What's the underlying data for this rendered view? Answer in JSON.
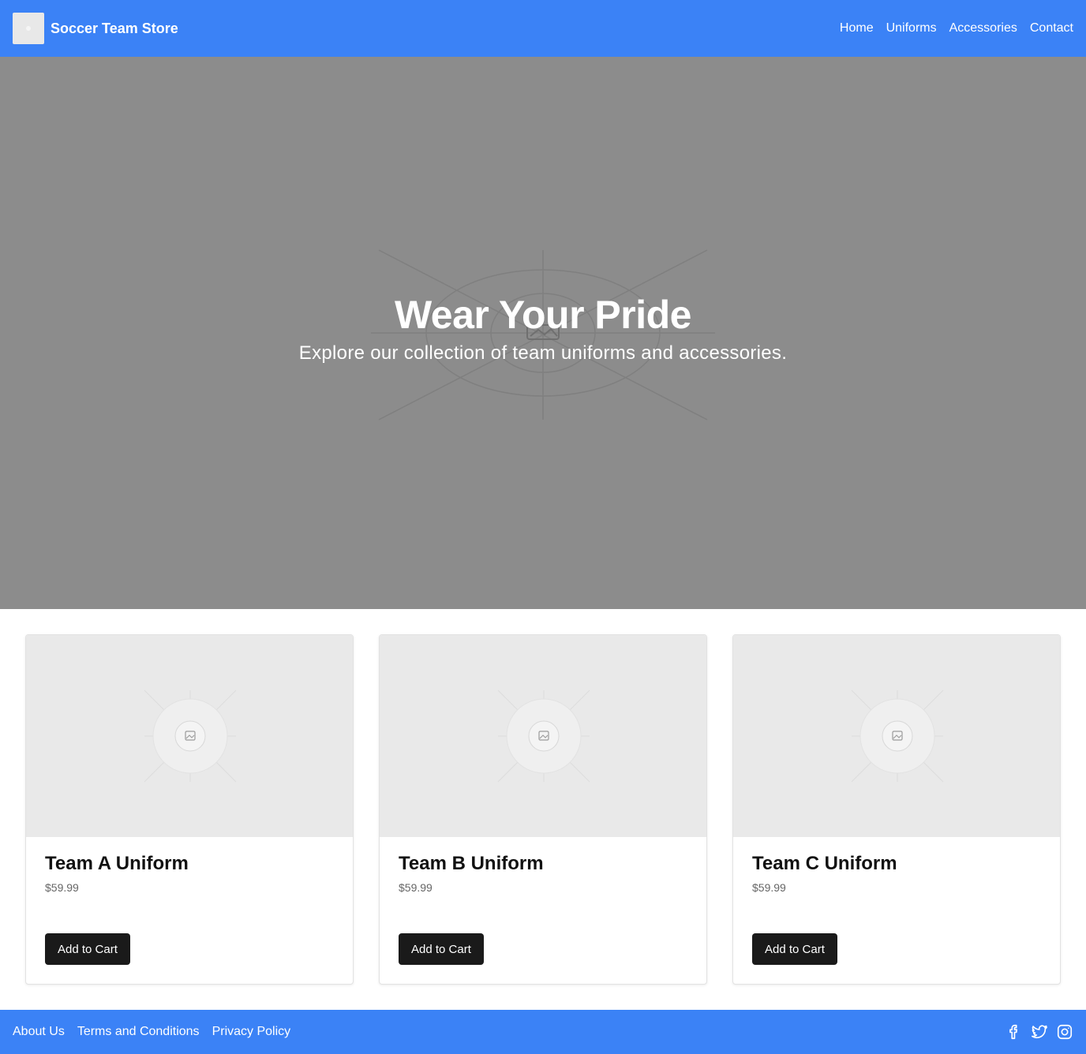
{
  "header": {
    "brand": "Soccer Team Store",
    "nav": [
      "Home",
      "Uniforms",
      "Accessories",
      "Contact"
    ]
  },
  "hero": {
    "title": "Wear Your Pride",
    "subtitle": "Explore our collection of team uniforms and accessories."
  },
  "products": [
    {
      "name": "Team A Uniform",
      "price": "$59.99",
      "button": "Add to Cart"
    },
    {
      "name": "Team B Uniform",
      "price": "$59.99",
      "button": "Add to Cart"
    },
    {
      "name": "Team C Uniform",
      "price": "$59.99",
      "button": "Add to Cart"
    }
  ],
  "footer": {
    "links": [
      "About Us",
      "Terms and Conditions",
      "Privacy Policy"
    ],
    "social_icons": [
      "facebook-icon",
      "twitter-icon",
      "instagram-icon"
    ]
  },
  "colors": {
    "primary": "#3b82f6",
    "hero_bg": "#8c8c8c",
    "button": "#1a1a1a"
  }
}
